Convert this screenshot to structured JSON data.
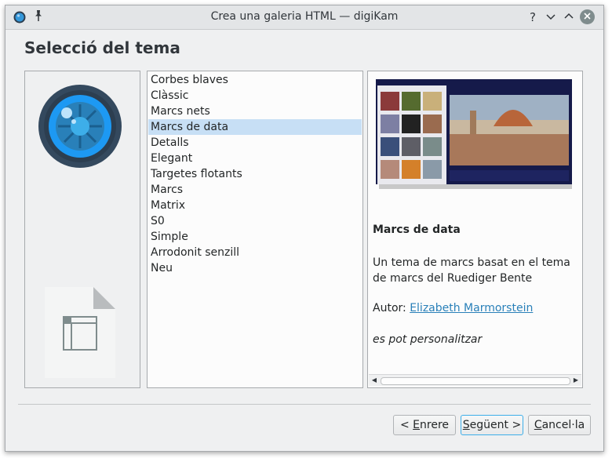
{
  "window": {
    "title": "Crea una galeria HTML — digiKam"
  },
  "titlebar": {
    "help_glyph": "?",
    "minimize_glyph": "⌄",
    "maximize_glyph": "⌃",
    "close_glyph": "✕",
    "pin_glyph": "📌"
  },
  "page": {
    "heading": "Selecció del tema"
  },
  "themes": {
    "items": [
      "Corbes blaves",
      "Clàssic",
      "Marcs nets",
      "Marcs de data",
      "Detalls",
      "Elegant",
      "Targetes flotants",
      "Marcs",
      "Matrix",
      "S0",
      "Simple",
      "Arrodonit senzill",
      "Neu"
    ],
    "selected_index": 3
  },
  "preview": {
    "title": "Marcs de data",
    "description": "Un tema de marcs basat en el tema de marcs del Ruediger Bente",
    "author_label": "Autor: ",
    "author_name": "Elizabeth Marmorstein",
    "customizable": "es pot personalitzar"
  },
  "buttons": {
    "back": {
      "prefix": "< ",
      "mnemonic": "E",
      "rest": "nrere"
    },
    "next": {
      "mnemonic": "S",
      "rest": "egüent >"
    },
    "cancel": {
      "mnemonic": "C",
      "rest": "ancel·la"
    }
  },
  "colors": {
    "selection": "#c7dff5",
    "link": "#2980b9",
    "focus": "#3daee9"
  }
}
